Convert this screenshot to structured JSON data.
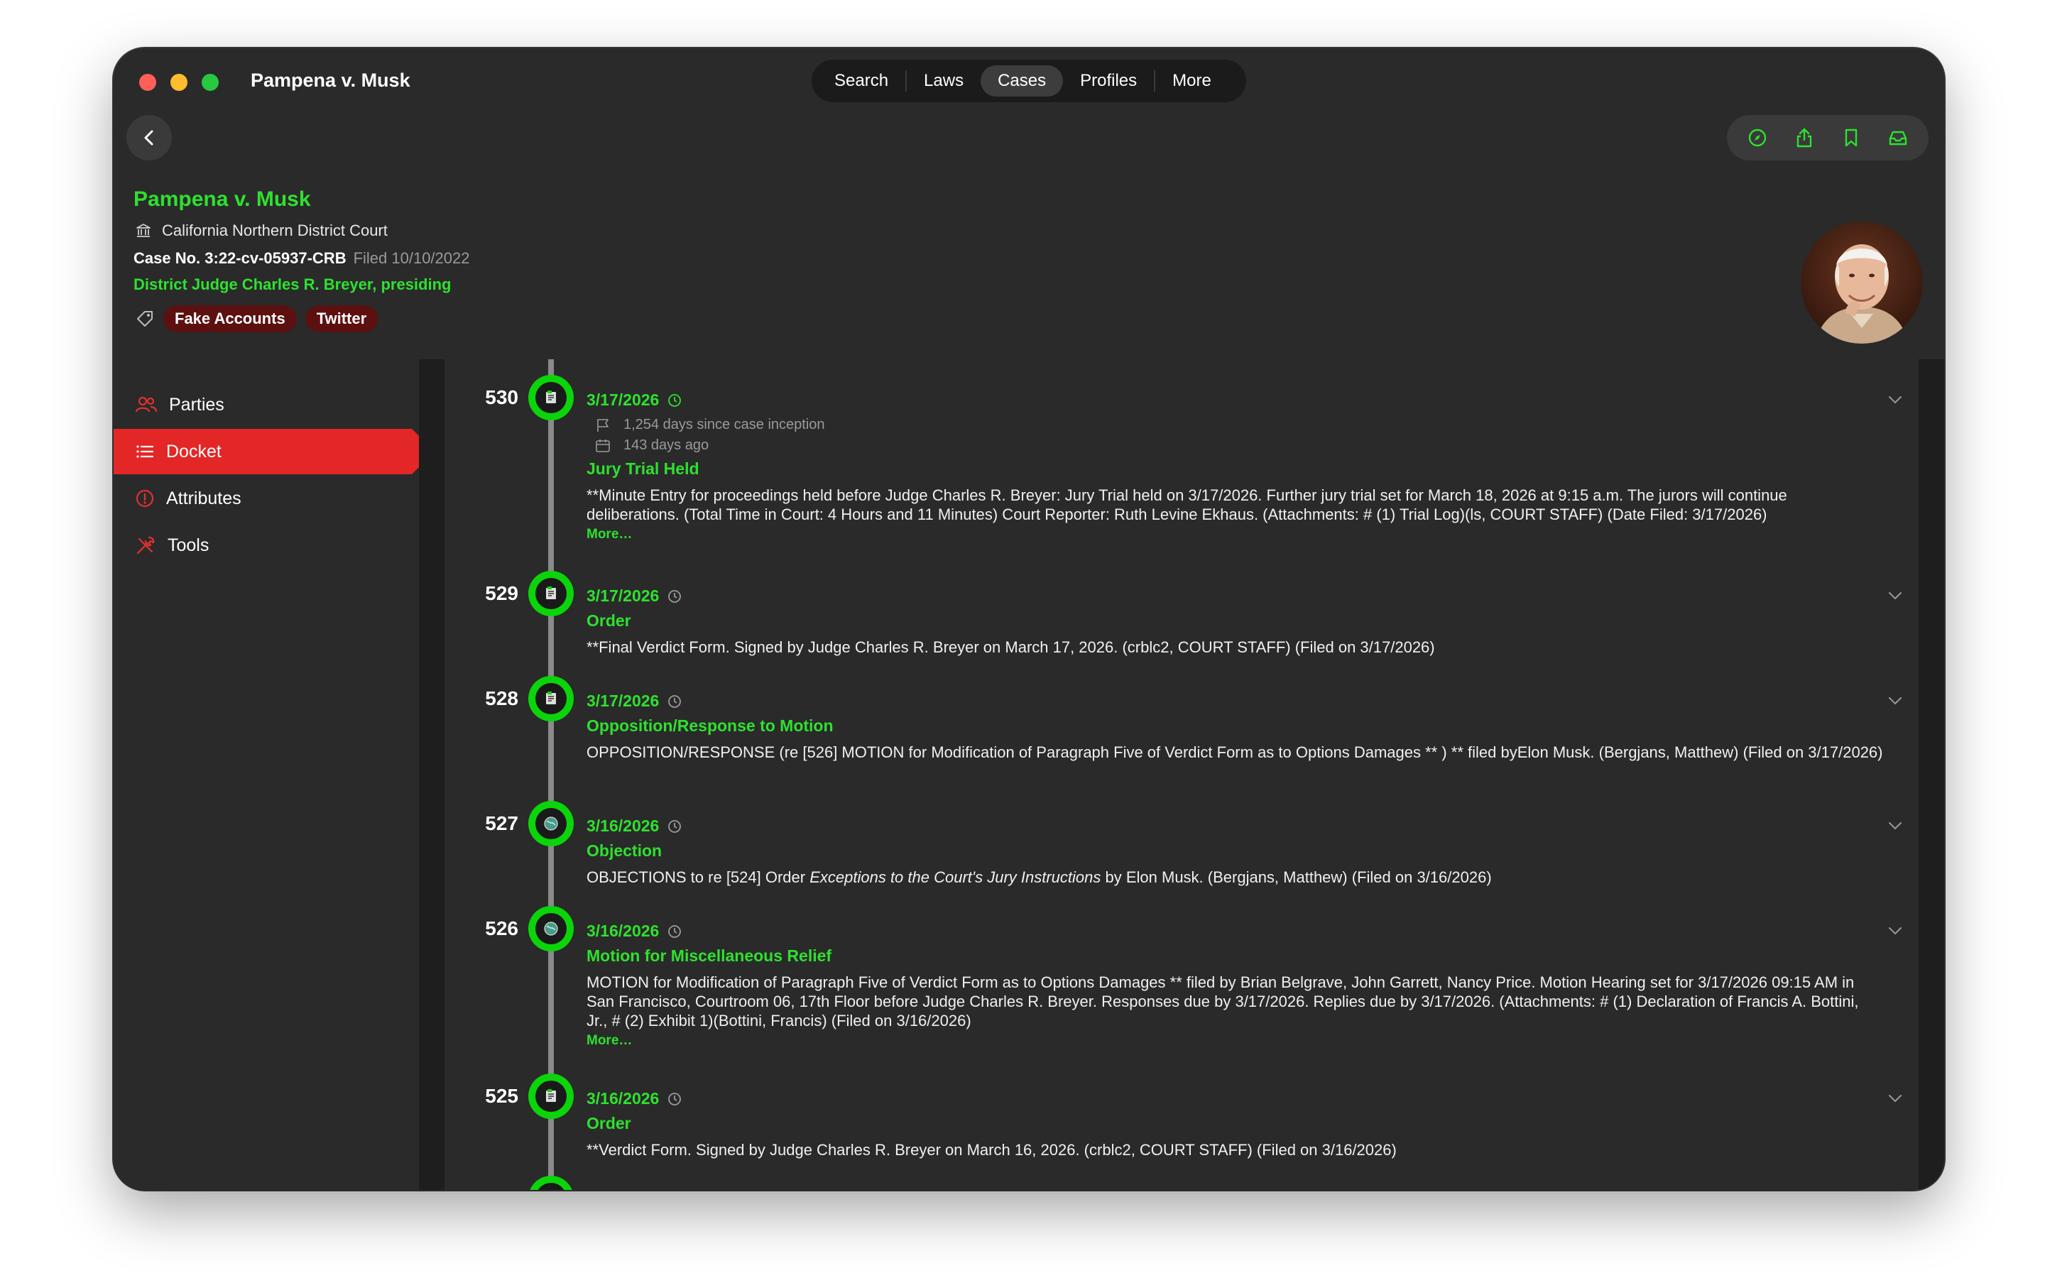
{
  "window": {
    "title": "Pampena v. Musk"
  },
  "nav": {
    "tabs": [
      "Search",
      "Laws",
      "Cases",
      "Profiles",
      "More"
    ],
    "active": "Cases"
  },
  "case": {
    "title": "Pampena v. Musk",
    "court": "California Northern District Court",
    "case_number": "Case No. 3:22-cv-05937-CRB",
    "filed": "Filed 10/10/2022",
    "judge": "District Judge Charles R. Breyer, presiding",
    "tags": [
      "Fake Accounts",
      "Twitter"
    ]
  },
  "sidebar": {
    "items": [
      {
        "label": "Parties",
        "icon": "people-icon"
      },
      {
        "label": "Docket",
        "icon": "list-icon"
      },
      {
        "label": "Attributes",
        "icon": "info-icon"
      },
      {
        "label": "Tools",
        "icon": "tools-icon"
      }
    ],
    "active": "Docket"
  },
  "docket": [
    {
      "number": "530",
      "date": "3/17/2026",
      "since_inception": "1,254 days since case inception",
      "ago": "143 days ago",
      "type": "Jury Trial Held",
      "description": "**Minute Entry for proceedings held before Judge Charles R. Breyer: Jury Trial held on 3/17/2026. Further jury trial set for March 18, 2026 at 9:15 a.m. The jurors will continue deliberations. (Total Time in Court: 4 Hours and 11 Minutes) Court Reporter: Ruth Levine Ekhaus. (Attachments: # (1) Trial Log)(ls, COURT STAFF) (Date Filed: 3/17/2026)",
      "more": "More…"
    },
    {
      "number": "529",
      "date": "3/17/2026",
      "type": "Order",
      "description": "**Final Verdict Form. Signed by Judge Charles R. Breyer on March 17, 2026. (crblc2, COURT STAFF) (Filed on 3/17/2026)"
    },
    {
      "number": "528",
      "date": "3/17/2026",
      "type": "Opposition/Response to Motion",
      "description": "OPPOSITION/RESPONSE (re [526] MOTION for Modification of Paragraph Five of Verdict Form as to Options Damages ** ) ** filed byElon Musk. (Bergjans, Matthew) (Filed on 3/17/2026)"
    },
    {
      "number": "527",
      "date": "3/16/2026",
      "type": "Objection",
      "desc_pre": "OBJECTIONS to re [524] Order ",
      "desc_italic": "Exceptions to the Court's Jury Instructions",
      "desc_post": " by Elon Musk. (Bergjans, Matthew) (Filed on 3/16/2026)"
    },
    {
      "number": "526",
      "date": "3/16/2026",
      "type": "Motion for Miscellaneous Relief",
      "description": "MOTION for Modification of Paragraph Five of Verdict Form as to Options Damages ** filed by Brian Belgrave, John Garrett, Nancy Price. Motion Hearing set for 3/17/2026 09:15 AM in San Francisco, Courtroom 06, 17th Floor before Judge Charles R. Breyer. Responses due by 3/17/2026. Replies due by 3/17/2026. (Attachments: # (1) Declaration of Francis A. Bottini, Jr., # (2) Exhibit 1)(Bottini, Francis) (Filed on 3/16/2026)",
      "more": "More…"
    },
    {
      "number": "525",
      "date": "3/16/2026",
      "type": "Order",
      "description": "**Verdict Form. Signed by Judge Charles R. Breyer on March 16, 2026. (crblc2, COURT STAFF) (Filed on 3/16/2026)"
    }
  ],
  "colors": {
    "accent_green": "#2ee12e",
    "accent_red": "#e32626",
    "tag_bg": "#5c1010"
  }
}
